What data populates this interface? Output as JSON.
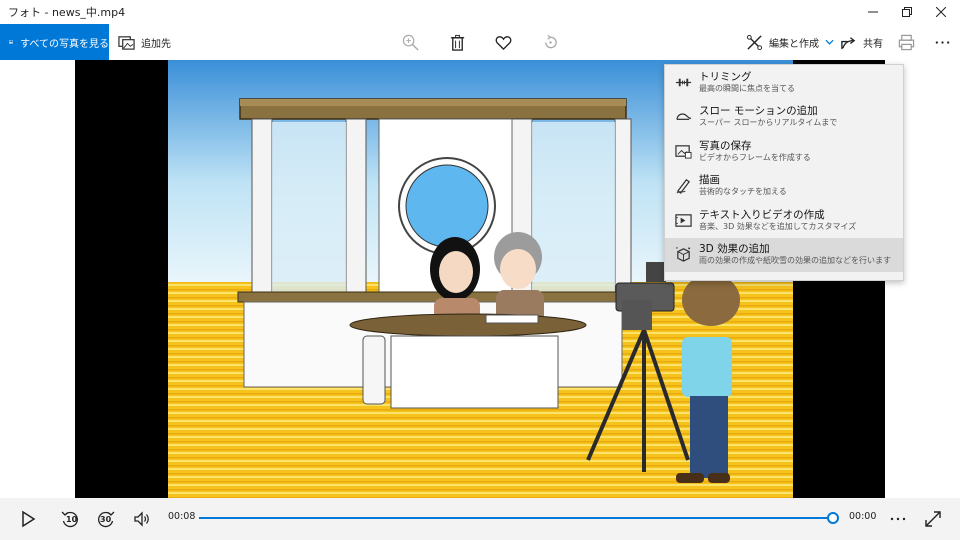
{
  "window": {
    "title": "フォト - news_中.mp4"
  },
  "toolbar": {
    "all_photos_label": "すべての写真を見る",
    "add_to_label": "追加先",
    "edit_create_label": "編集と作成",
    "share_label": "共有"
  },
  "menu": {
    "items": [
      {
        "title": "トリミング",
        "subtitle": "最高の瞬間に焦点を当てる",
        "icon": "trim-icon"
      },
      {
        "title": "スロー モーションの追加",
        "subtitle": "スーパー スローからリアルタイムまで",
        "icon": "slow-motion-icon"
      },
      {
        "title": "写真の保存",
        "subtitle": "ビデオからフレームを作成する",
        "icon": "save-photo-icon"
      },
      {
        "title": "描画",
        "subtitle": "芸術的なタッチを加える",
        "icon": "draw-icon"
      },
      {
        "title": "テキスト入りビデオの作成",
        "subtitle": "音楽、3D 効果などを追加してカスタマイズ",
        "icon": "text-video-icon"
      },
      {
        "title": "3D 効果の追加",
        "subtitle": "雨の効果の作成や紙吹雪の効果の追加などを行います",
        "icon": "effects-3d-icon"
      }
    ],
    "highlighted_index": 5
  },
  "player": {
    "rewind_seconds": "10",
    "forward_seconds": "30",
    "current_time": "00:08",
    "remaining_time": "00:00",
    "progress": 1.0
  },
  "colors": {
    "accent": "#0078d7",
    "menu_bg": "#f2f2f2",
    "menu_highlight": "#dadada"
  }
}
